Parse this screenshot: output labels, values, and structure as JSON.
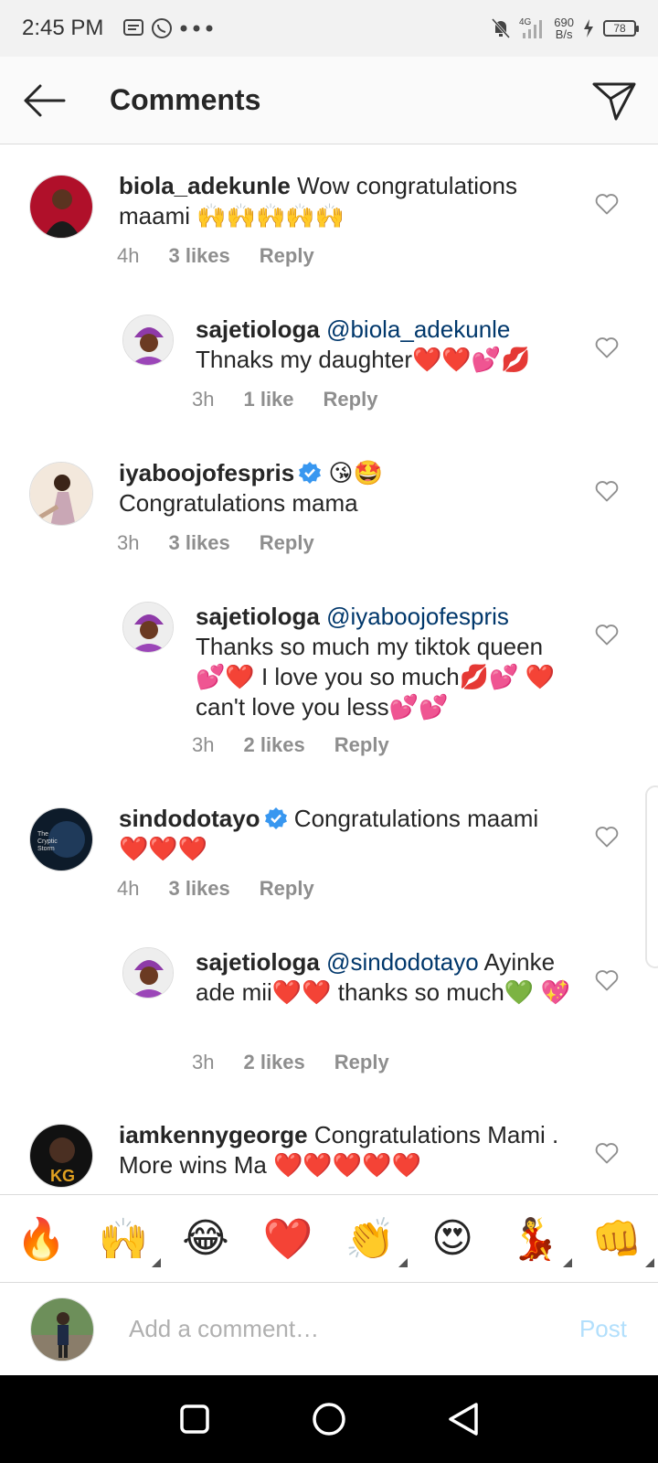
{
  "status_bar": {
    "time": "2:45 PM",
    "network": "4G",
    "speed_value": "690",
    "speed_unit": "B/s",
    "battery": "78"
  },
  "header": {
    "title": "Comments"
  },
  "comments": [
    {
      "username": "biola_adekunle",
      "text": "Wow congratulations maami 🙌🙌🙌🙌🙌",
      "time": "4h",
      "likes": "3 likes",
      "reply_label": "Reply",
      "verified": false
    },
    {
      "username": "sajetiologa",
      "mention": "@biola_adekunle",
      "text": "Thnaks my daughter❤️❤️💕💋",
      "time": "3h",
      "likes": "1 like",
      "reply_label": "Reply"
    },
    {
      "username": "iyaboojofespris",
      "emojis": "😘🤩",
      "text": "Congratulations mama",
      "time": "3h",
      "likes": "3 likes",
      "reply_label": "Reply",
      "verified": true
    },
    {
      "username": "sajetiologa",
      "mention": "@iyaboojofespris",
      "text": "Thanks so much my tiktok queen 💕❤️ I love you so much💋💕 ❤️ can't love you less💕💕",
      "time": "3h",
      "likes": "2 likes",
      "reply_label": "Reply"
    },
    {
      "username": "sindodotayo",
      "text": "Congratulations maami ❤️❤️❤️",
      "time": "4h",
      "likes": "3 likes",
      "reply_label": "Reply",
      "verified": true
    },
    {
      "username": "sajetiologa",
      "mention": "@sindodotayo",
      "text": "Ayinke ade mii❤️❤️ thanks so much💚 💖",
      "time": "3h",
      "likes": "2 likes",
      "reply_label": "Reply"
    },
    {
      "username": "iamkennygeorge",
      "text": "Congratulations Mami . More wins Ma ❤️❤️❤️❤️❤️"
    }
  ],
  "emoji_bar": [
    "🔥",
    "🙌",
    "😂",
    "❤️",
    "👏",
    "😍",
    "💃",
    "👊"
  ],
  "input": {
    "placeholder": "Add a comment…",
    "post_label": "Post"
  },
  "colors": {
    "mention": "#00376b",
    "verified": "#3897f0",
    "post_disabled": "#b2dffc",
    "meta_gray": "#8e8e8e"
  }
}
